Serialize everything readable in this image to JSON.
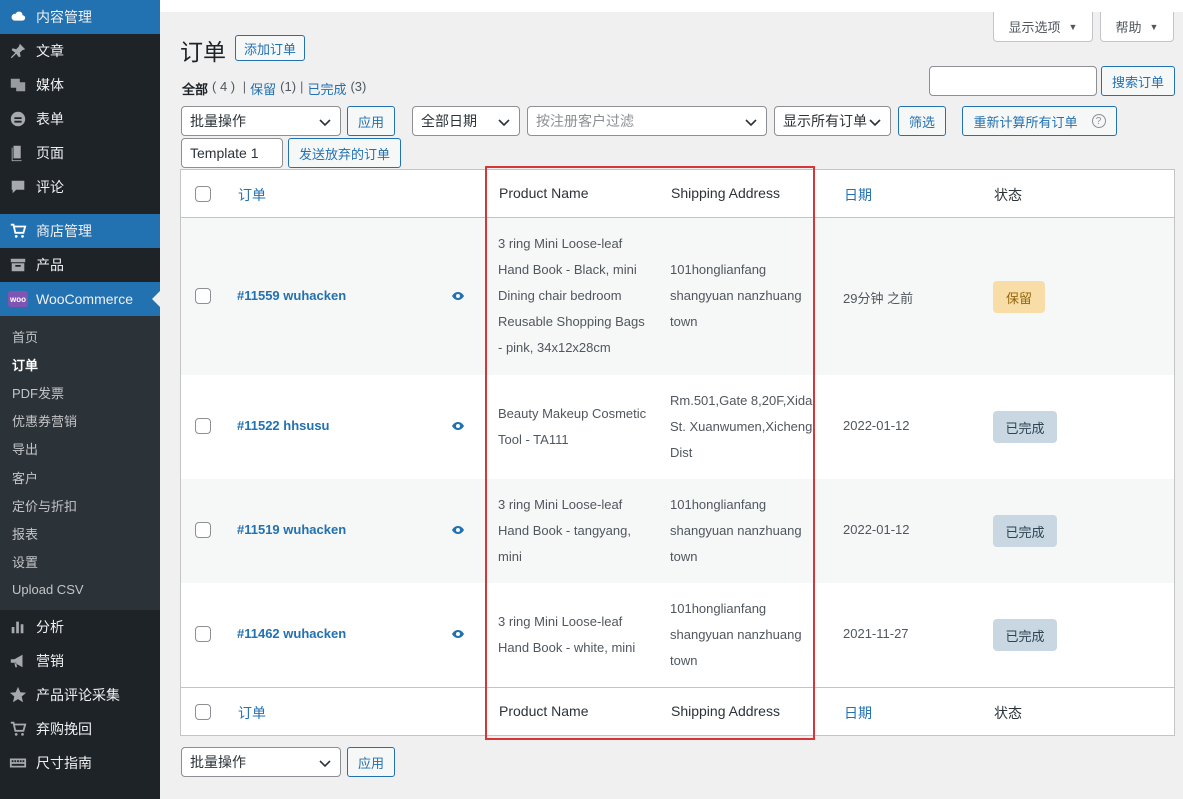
{
  "sidebar": {
    "items": [
      {
        "label": "内容管理",
        "icon": "cloud-icon",
        "state": "active"
      },
      {
        "label": "文章",
        "icon": "pin-icon"
      },
      {
        "label": "媒体",
        "icon": "media-icon"
      },
      {
        "label": "表单",
        "icon": "form-icon"
      },
      {
        "label": "页面",
        "icon": "page-icon"
      },
      {
        "label": "评论",
        "icon": "comment-icon"
      },
      {
        "label": "商店管理",
        "icon": "cart-icon",
        "state": "active"
      },
      {
        "label": "产品",
        "icon": "archive-icon"
      },
      {
        "label": "WooCommerce",
        "icon": "woo-icon",
        "badge": "woo",
        "state": "current-parent"
      }
    ],
    "submenu": [
      "首页",
      "订单",
      "PDF发票",
      "优惠券营销",
      "导出",
      "客户",
      "定价与折扣",
      "报表",
      "设置",
      "Upload CSV"
    ],
    "submenu_current": "订单",
    "bottom_items": [
      {
        "label": "分析",
        "icon": "chart-bar-icon"
      },
      {
        "label": "营销",
        "icon": "megaphone-icon"
      },
      {
        "label": "产品评论采集",
        "icon": "star-icon"
      },
      {
        "label": "弃购挽回",
        "icon": "cart-icon"
      },
      {
        "label": "尺寸指南",
        "icon": "keyboard-icon"
      }
    ]
  },
  "screen_meta": {
    "options_label": "显示选项",
    "help_label": "帮助"
  },
  "header": {
    "title": "订单",
    "add_label": "添加订单"
  },
  "filters_nav": {
    "all_label": "全部",
    "all_count": "( 4 )",
    "hold_label": "保留",
    "hold_count": "(1)",
    "done_label": "已完成",
    "done_count": "(3)"
  },
  "search": {
    "button_label": "搜索订单",
    "value": ""
  },
  "toolbar": {
    "bulk_label": "批量操作",
    "apply_label": "应用",
    "date_label": "全部日期",
    "customer_placeholder": "按注册客户过滤",
    "show_orders_label": "显示所有订单",
    "filter_label": "筛选",
    "recalc_label": "重新计算所有订单",
    "template_label": "Template 1",
    "send_abandoned_label": "发送放弃的订单"
  },
  "table": {
    "columns": {
      "order": "订单",
      "product": "Product Name",
      "shipping": "Shipping Address",
      "date": "日期",
      "status": "状态"
    },
    "rows": [
      {
        "order": "#11559 wuhacken",
        "product": [
          "3 ring Mini Loose-leaf",
          "Hand Book - Black, mini",
          "Dining chair bedroom",
          "Reusable Shopping Bags",
          "- pink, 34x12x28cm"
        ],
        "shipping": [
          "101honglianfang",
          "shangyuan nanzhuang",
          "town"
        ],
        "date": "29分钟 之前",
        "status": "保留",
        "status_kind": "hold"
      },
      {
        "order": "#11522 hhsusu",
        "product": [
          "Beauty Makeup Cosmetic",
          "Tool - TA111"
        ],
        "shipping": [
          "Rm.501,Gate 8,20F,Xida",
          "St. Xuanwumen,Xicheng",
          "Dist"
        ],
        "date": "2022-01-12",
        "status": "已完成",
        "status_kind": "done"
      },
      {
        "order": "#11519 wuhacken",
        "product": [
          "3 ring Mini Loose-leaf",
          "Hand Book - tangyang,",
          "mini"
        ],
        "shipping": [
          "101honglianfang",
          "shangyuan nanzhuang",
          "town"
        ],
        "date": "2022-01-12",
        "status": "已完成",
        "status_kind": "done"
      },
      {
        "order": "#11462 wuhacken",
        "product": [
          "3 ring Mini Loose-leaf",
          "Hand Book - white, mini"
        ],
        "shipping": [
          "101honglianfang",
          "shangyuan nanzhuang",
          "town"
        ],
        "date": "2021-11-27",
        "status": "已完成",
        "status_kind": "done"
      }
    ]
  },
  "bottom_toolbar": {
    "bulk_label": "批量操作",
    "apply_label": "应用"
  },
  "colors": {
    "sidebar_bg": "#1d2327",
    "accent": "#2271b1",
    "highlight": "#d63638",
    "hold_bg": "#f8dda7",
    "done_bg": "#c8d7e1"
  }
}
